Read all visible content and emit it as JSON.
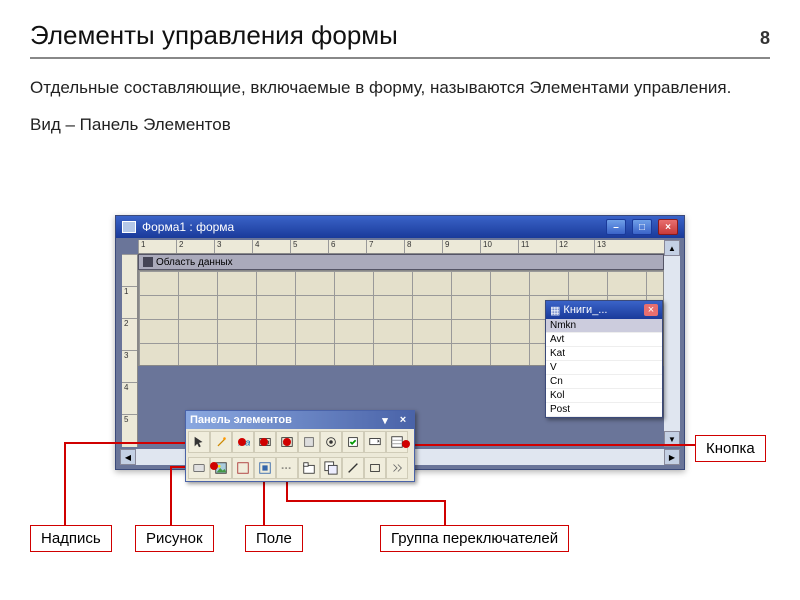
{
  "header": {
    "title": "Элементы управления формы",
    "page": "8"
  },
  "body": {
    "p1": "Отдельные составляющие, включаемые в форму, называются Элементами управления.",
    "p2": "Вид – Панель Элементов"
  },
  "formWindow": {
    "title": "Форма1 : форма",
    "sectionHeader": "Область данных"
  },
  "toolbox": {
    "title": "Панель элементов"
  },
  "fieldList": {
    "title": "Книги_...",
    "items": [
      "Nmkn",
      "Avt",
      "Kat",
      "V",
      "Cn",
      "Kol",
      "Post"
    ]
  },
  "callouts": {
    "label": "Надпись",
    "picture": "Рисунок",
    "field": "Поле",
    "optgroup": "Группа переключателей",
    "button": "Кнопка"
  },
  "ruler": {
    "h": [
      "1",
      "2",
      "3",
      "4",
      "5",
      "6",
      "7",
      "8",
      "9",
      "10",
      "11",
      "12",
      "13"
    ],
    "v": [
      "",
      "1",
      "2",
      "3",
      "4",
      "5"
    ]
  }
}
